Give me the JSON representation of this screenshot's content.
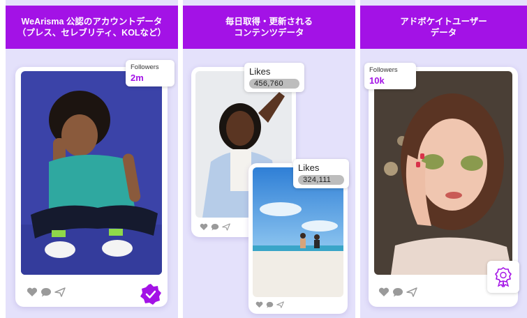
{
  "columns": [
    {
      "header_lines": [
        "WeArisma 公認のアカウントデータ",
        "（プレス、セレブリティ、KOLなど）"
      ],
      "badge": {
        "label": "Followers",
        "value": "2m"
      }
    },
    {
      "header_lines": [
        "毎日取得・更新される",
        "コンテンツデータ"
      ],
      "post_1": {
        "label": "Likes",
        "value": "456,760"
      },
      "post_2": {
        "label": "Likes",
        "value": "324,111"
      }
    },
    {
      "header_lines": [
        "アドボケイトユーザー",
        "データ"
      ],
      "badge": {
        "label": "Followers",
        "value": "10k"
      }
    }
  ],
  "colors": {
    "accent": "#a312e6",
    "panel_background": "#e4e1fb",
    "action_icons": "#9a9a9a"
  },
  "icons": [
    "heart-icon",
    "comment-icon",
    "send-icon",
    "verified-badge-icon",
    "award-ribbon-icon"
  ]
}
